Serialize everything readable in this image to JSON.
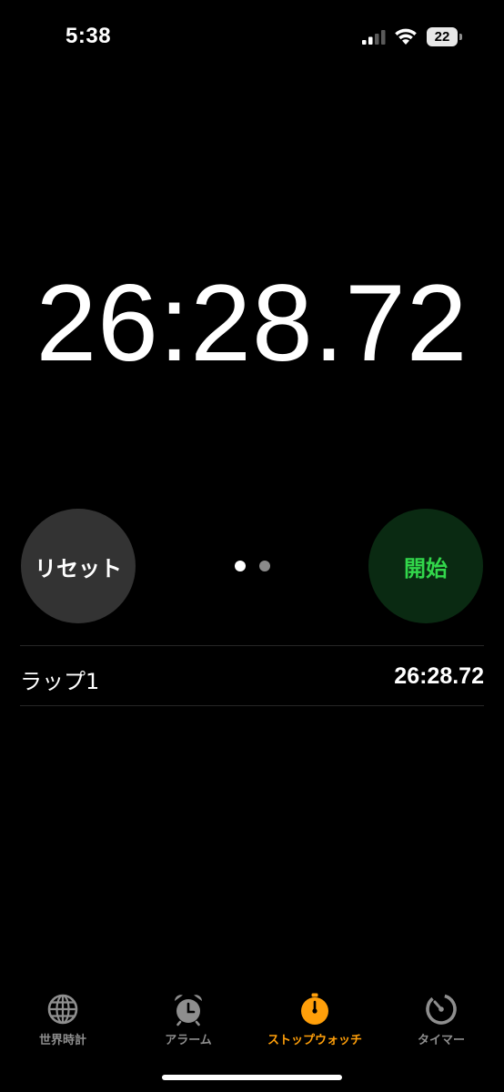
{
  "status_bar": {
    "time": "5:38",
    "battery": "22"
  },
  "stopwatch": {
    "elapsed": "26:28.72"
  },
  "buttons": {
    "reset_label": "リセット",
    "start_label": "開始"
  },
  "page_indicator": {
    "count": 2,
    "active_index": 0
  },
  "laps": [
    {
      "label": "ラップ1",
      "time": "26:28.72"
    }
  ],
  "tab_bar": {
    "tabs": [
      {
        "label": "世界時計",
        "icon": "globe-icon"
      },
      {
        "label": "アラーム",
        "icon": "alarm-clock-icon"
      },
      {
        "label": "ストップウォッチ",
        "icon": "stopwatch-icon"
      },
      {
        "label": "タイマー",
        "icon": "timer-icon"
      }
    ],
    "active_index": 2
  },
  "colors": {
    "background": "#000000",
    "accent": "#ff9f0a",
    "start_text": "#32d74b",
    "start_bg": "#0a2a12",
    "reset_bg": "#333333",
    "inactive_tab": "#8e8e8e"
  }
}
